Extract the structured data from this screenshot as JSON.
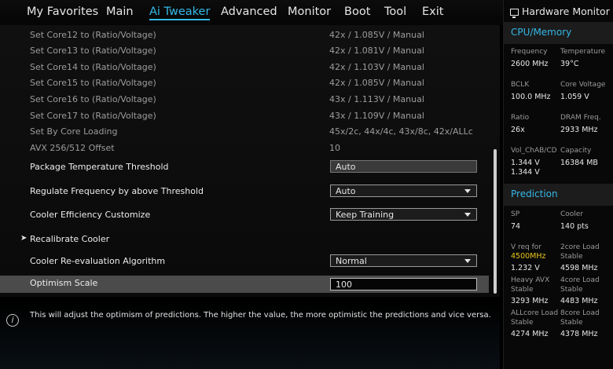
{
  "nav": {
    "tabs": [
      "My Favorites",
      "Main",
      "Ai Tweaker",
      "Advanced",
      "Monitor",
      "Boot",
      "Tool",
      "Exit"
    ],
    "active": "Ai Tweaker"
  },
  "settings": [
    {
      "label": "Set Core12 to (Ratio/Voltage)",
      "value": "42x / 1.085V / Manual"
    },
    {
      "label": "Set Core13 to (Ratio/Voltage)",
      "value": "42x / 1.081V / Manual"
    },
    {
      "label": "Set Core14 to (Ratio/Voltage)",
      "value": "42x / 1.103V / Manual"
    },
    {
      "label": "Set Core15 to (Ratio/Voltage)",
      "value": "42x / 1.085V / Manual"
    },
    {
      "label": "Set Core16 to (Ratio/Voltage)",
      "value": "43x / 1.113V / Manual"
    },
    {
      "label": "Set Core17 to (Ratio/Voltage)",
      "value": "43x / 1.109V / Manual"
    },
    {
      "label": "Set By Core Loading",
      "value": "45x/2c, 44x/4c, 43x/8c, 42x/ALLc"
    },
    {
      "label": "AVX 256/512 Offset",
      "value": "10"
    }
  ],
  "options": {
    "pkg_temp": {
      "label": "Package Temperature Threshold",
      "value": "Auto"
    },
    "regulate": {
      "label": "Regulate Frequency by above Threshold",
      "value": "Auto"
    },
    "cooler_eff": {
      "label": "Cooler Efficiency Customize",
      "value": "Keep Training"
    },
    "recalibrate": {
      "label": "Recalibrate Cooler"
    },
    "reeval": {
      "label": "Cooler Re-evaluation Algorithm",
      "value": "Normal"
    },
    "optimism": {
      "label": "Optimism Scale",
      "value": "100"
    }
  },
  "help_text": "This will adjust the optimism of predictions. The higher the value, the more optimistic the predictions and vice versa.",
  "hardware_monitor": {
    "title": "Hardware Monitor",
    "cpu_memory": {
      "title": "CPU/Memory",
      "frequency": {
        "label": "Frequency",
        "value": "2600 MHz"
      },
      "temperature": {
        "label": "Temperature",
        "value": "39°C"
      },
      "bclk": {
        "label": "BCLK",
        "value": "100.0 MHz"
      },
      "core_voltage": {
        "label": "Core Voltage",
        "value": "1.059 V"
      },
      "ratio": {
        "label": "Ratio",
        "value": "26x"
      },
      "dram_freq": {
        "label": "DRAM Freq.",
        "value": "2933 MHz"
      },
      "vol_chab": {
        "label": "Vol_ChAB/CD",
        "value1": "1.344 V",
        "value2": "1.344 V"
      },
      "capacity": {
        "label": "Capacity",
        "value": "16384 MB"
      }
    },
    "prediction": {
      "title": "Prediction",
      "sp": {
        "label": "SP",
        "value": "74"
      },
      "cooler": {
        "label": "Cooler",
        "value": "140 pts"
      },
      "vreq": {
        "label": "V req for",
        "freq": "4500MHz",
        "value": "1.232 V"
      },
      "core2": {
        "label1": "2core Load",
        "label2": "Stable",
        "value": "4598 MHz"
      },
      "heavy_avx": {
        "label1": "Heavy AVX",
        "label2": "Stable",
        "value": "3293 MHz"
      },
      "core4": {
        "label1": "4core Load",
        "label2": "Stable",
        "value": "4483 MHz"
      },
      "allcore": {
        "label1": "ALLcore Load",
        "label2": "Stable",
        "value": "4274 MHz"
      },
      "core8": {
        "label1": "8core Load",
        "label2": "Stable",
        "value": "4378 MHz"
      }
    }
  },
  "colors": {
    "accent": "#35b7e6",
    "highlight": "#e8c51a",
    "selected_row": "#4b4b4b"
  }
}
